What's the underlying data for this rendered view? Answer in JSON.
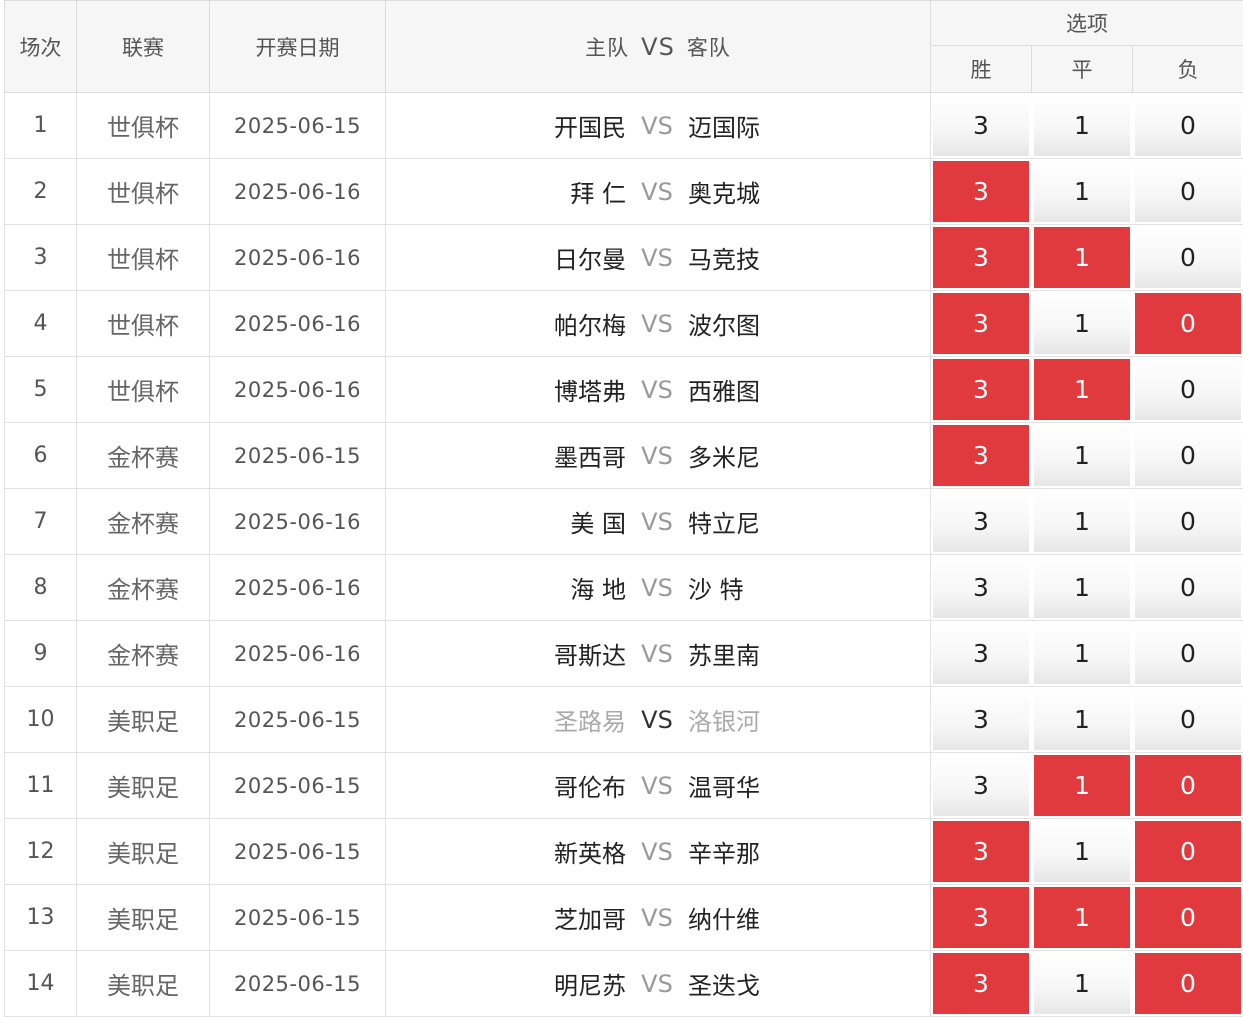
{
  "header": {
    "idx": "场次",
    "league": "联赛",
    "date": "开赛日期",
    "home": "主队",
    "vs": "VS",
    "away": "客队",
    "options": "选项",
    "win": "胜",
    "draw": "平",
    "lose": "负"
  },
  "rows": [
    {
      "idx": "1",
      "league": "世俱杯",
      "date": "2025-06-15",
      "home": "开国民",
      "vs": "VS",
      "away": "迈国际",
      "win": "3",
      "draw": "1",
      "lose": "0",
      "sel": [
        false,
        false,
        false
      ]
    },
    {
      "idx": "2",
      "league": "世俱杯",
      "date": "2025-06-16",
      "home": "拜 仁",
      "vs": "VS",
      "away": "奥克城",
      "win": "3",
      "draw": "1",
      "lose": "0",
      "sel": [
        true,
        false,
        false
      ]
    },
    {
      "idx": "3",
      "league": "世俱杯",
      "date": "2025-06-16",
      "home": "日尔曼",
      "vs": "VS",
      "away": "马竞技",
      "win": "3",
      "draw": "1",
      "lose": "0",
      "sel": [
        true,
        true,
        false
      ]
    },
    {
      "idx": "4",
      "league": "世俱杯",
      "date": "2025-06-16",
      "home": "帕尔梅",
      "vs": "VS",
      "away": "波尔图",
      "win": "3",
      "draw": "1",
      "lose": "0",
      "sel": [
        true,
        false,
        true
      ]
    },
    {
      "idx": "5",
      "league": "世俱杯",
      "date": "2025-06-16",
      "home": "博塔弗",
      "vs": "VS",
      "away": "西雅图",
      "win": "3",
      "draw": "1",
      "lose": "0",
      "sel": [
        true,
        true,
        false
      ]
    },
    {
      "idx": "6",
      "league": "金杯赛",
      "date": "2025-06-15",
      "home": "墨西哥",
      "vs": "VS",
      "away": "多米尼",
      "win": "3",
      "draw": "1",
      "lose": "0",
      "sel": [
        true,
        false,
        false
      ]
    },
    {
      "idx": "7",
      "league": "金杯赛",
      "date": "2025-06-16",
      "home": "美 国",
      "vs": "VS",
      "away": "特立尼",
      "win": "3",
      "draw": "1",
      "lose": "0",
      "sel": [
        false,
        false,
        false
      ]
    },
    {
      "idx": "8",
      "league": "金杯赛",
      "date": "2025-06-16",
      "home": "海 地",
      "vs": "VS",
      "away": "沙 特",
      "win": "3",
      "draw": "1",
      "lose": "0",
      "sel": [
        false,
        false,
        false
      ]
    },
    {
      "idx": "9",
      "league": "金杯赛",
      "date": "2025-06-16",
      "home": "哥斯达",
      "vs": "VS",
      "away": "苏里南",
      "win": "3",
      "draw": "1",
      "lose": "0",
      "sel": [
        false,
        false,
        false
      ]
    },
    {
      "idx": "10",
      "league": "美职足",
      "date": "2025-06-15",
      "home": "圣路易",
      "vs": "VS",
      "away": "洛银河",
      "win": "3",
      "draw": "1",
      "lose": "0",
      "sel": [
        false,
        false,
        false
      ],
      "muted": true
    },
    {
      "idx": "11",
      "league": "美职足",
      "date": "2025-06-15",
      "home": "哥伦布",
      "vs": "VS",
      "away": "温哥华",
      "win": "3",
      "draw": "1",
      "lose": "0",
      "sel": [
        false,
        true,
        true
      ]
    },
    {
      "idx": "12",
      "league": "美职足",
      "date": "2025-06-15",
      "home": "新英格",
      "vs": "VS",
      "away": "辛辛那",
      "win": "3",
      "draw": "1",
      "lose": "0",
      "sel": [
        true,
        false,
        true
      ]
    },
    {
      "idx": "13",
      "league": "美职足",
      "date": "2025-06-15",
      "home": "芝加哥",
      "vs": "VS",
      "away": "纳什维",
      "win": "3",
      "draw": "1",
      "lose": "0",
      "sel": [
        true,
        true,
        true
      ]
    },
    {
      "idx": "14",
      "league": "美职足",
      "date": "2025-06-15",
      "home": "明尼苏",
      "vs": "VS",
      "away": "圣迭戈",
      "win": "3",
      "draw": "1",
      "lose": "0",
      "sel": [
        true,
        false,
        true
      ]
    }
  ],
  "colors": {
    "selected": "#e03a3e",
    "header_bg": "#f6f6f6"
  }
}
